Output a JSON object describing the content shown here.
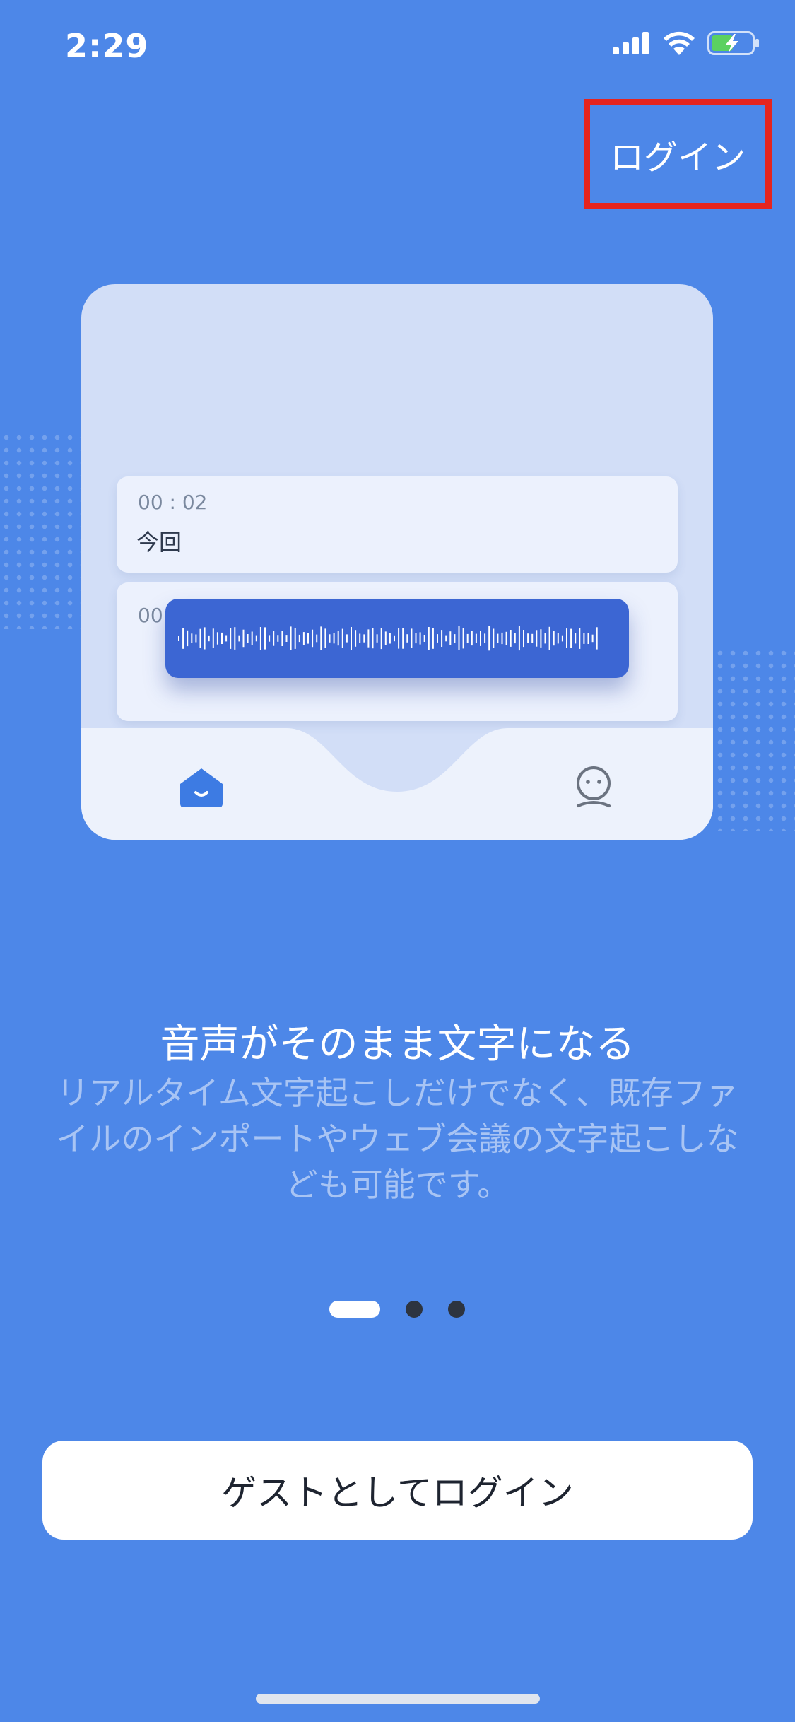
{
  "colors": {
    "background": "#4D87E8",
    "highlight_border": "#E5241E",
    "card": "#D2DEF7",
    "wave_pill": "#3C66D3"
  },
  "status_bar": {
    "time": "2:29",
    "icons": [
      "signal-icon",
      "wifi-icon",
      "battery-charging-icon"
    ]
  },
  "header": {
    "login_label": "ログイン"
  },
  "illustration": {
    "row1": {
      "time": "00 : 02",
      "text": "今回"
    },
    "row2": {
      "time": "00"
    },
    "tab_icons": [
      "home-icon",
      "profile-icon"
    ]
  },
  "onboarding": {
    "title": "音声がそのまま文字になる",
    "description": "リアルタイム文字起こしだけでなく、既存ファイルのインポートやウェブ会議の文字起こしなども可能です。"
  },
  "pager": {
    "current": 1,
    "total": 3
  },
  "actions": {
    "guest_login_label": "ゲストとしてログイン"
  }
}
